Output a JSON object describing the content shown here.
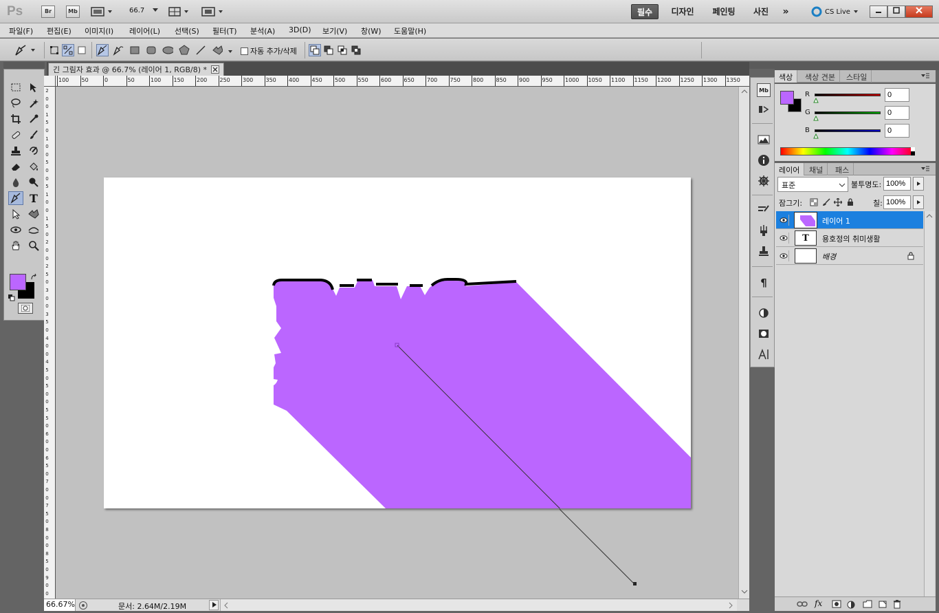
{
  "app": {
    "logo": "Ps",
    "bridge": "Br",
    "mini_bridge": "Mb",
    "zoom_dd": "66.7",
    "workspaces": [
      "필수",
      "디자인",
      "페인팅",
      "사진"
    ],
    "active_workspace": "필수",
    "more": "»",
    "cs_live": "CS Live"
  },
  "menu": [
    "파일(F)",
    "편집(E)",
    "이미지(I)",
    "레이어(L)",
    "선택(S)",
    "필터(T)",
    "분석(A)",
    "3D(D)",
    "보기(V)",
    "창(W)",
    "도움말(H)"
  ],
  "options": {
    "auto_add_delete": "자동 추가/삭제",
    "auto_add_checked": false
  },
  "document": {
    "tab_title": "긴 그림자 효과 @ 66.7% (레이어 1, RGB/8) *",
    "fill_color": "#bb66ff",
    "ruler_h": [
      "100",
      "50",
      "0",
      "50",
      "100",
      "150",
      "200",
      "250",
      "300",
      "350",
      "400",
      "450",
      "500",
      "550",
      "600",
      "650",
      "700",
      "750",
      "800",
      "850",
      "900",
      "950",
      "1000",
      "1050",
      "1100",
      "1150",
      "1200",
      "1250",
      "1300",
      "1350"
    ],
    "ruler_v": [
      "2",
      "0",
      "0",
      "1",
      "5",
      "0",
      "1",
      "0",
      "0",
      "5",
      "0",
      "0",
      "5",
      "1",
      "0",
      "0",
      "1",
      "5",
      "0",
      "2",
      "0",
      "0",
      "2",
      "5",
      "0",
      "3",
      "0",
      "0",
      "3",
      "5",
      "0",
      "4",
      "0",
      "0",
      "4",
      "5",
      "0",
      "5",
      "0",
      "0",
      "5",
      "5",
      "0",
      "6",
      "0",
      "0",
      "6",
      "5",
      "0",
      "7",
      "0",
      "0",
      "7",
      "5",
      "0",
      "8",
      "0",
      "0",
      "8",
      "5",
      "0",
      "9",
      "0",
      "0"
    ]
  },
  "status": {
    "zoom": "66.67%",
    "doc_size": "문서: 2.64M/2.19M"
  },
  "colors": {
    "foreground": "#bb66ff",
    "background": "#000000"
  },
  "color_panel": {
    "tabs": [
      "색상",
      "색상 견본",
      "스타일"
    ],
    "channels": [
      {
        "label": "R",
        "value": "0",
        "color": "#cc0000"
      },
      {
        "label": "G",
        "value": "0",
        "color": "#00aa00"
      },
      {
        "label": "B",
        "value": "0",
        "color": "#0000cc"
      }
    ]
  },
  "layers_panel": {
    "tabs": [
      "레이어",
      "채널",
      "패스"
    ],
    "blend_mode": "표준",
    "opacity_label": "불투명도:",
    "opacity": "100%",
    "lock_label": "잠그기:",
    "fill_label": "칠:",
    "fill": "100%",
    "layers": [
      {
        "name": "레이어 1",
        "type": "pixel",
        "selected": true
      },
      {
        "name": "용호정의 취미생활",
        "type": "text",
        "selected": false
      },
      {
        "name": "배경",
        "type": "background",
        "selected": false,
        "locked": true
      }
    ],
    "text_layer_thumb": "T"
  },
  "icons": {
    "fx": "fx"
  }
}
